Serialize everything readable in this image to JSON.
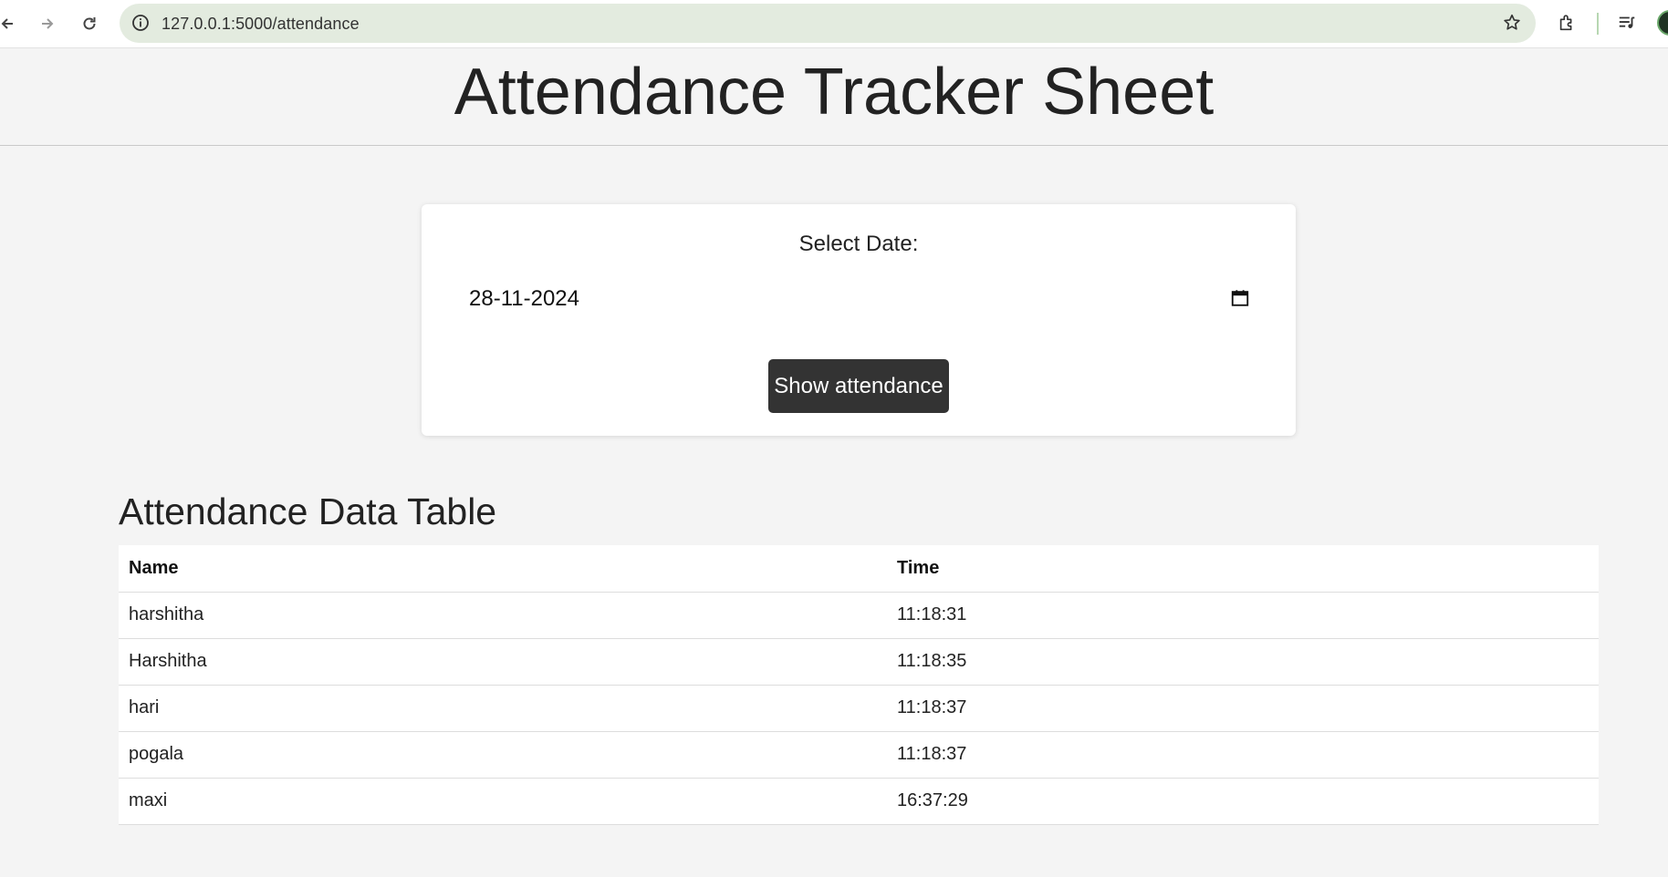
{
  "browser": {
    "url": "127.0.0.1:5000/attendance",
    "icons": [
      "back-arrow-icon",
      "forward-arrow-icon",
      "reload-icon",
      "site-info-icon",
      "bookmark-star-icon",
      "extensions-icon",
      "media-controls-icon",
      "profile-avatar"
    ]
  },
  "header": {
    "title": "Attendance Tracker Sheet"
  },
  "form": {
    "label": "Select Date:",
    "date_value": "28-11-2024",
    "button_label": "Show attendance"
  },
  "table": {
    "title": "Attendance Data Table",
    "columns": [
      "Name",
      "Time"
    ],
    "rows": [
      {
        "name": "harshitha",
        "time": "11:18:31"
      },
      {
        "name": "Harshitha",
        "time": "11:18:35"
      },
      {
        "name": "hari",
        "time": "11:18:37"
      },
      {
        "name": "pogala",
        "time": "11:18:37"
      },
      {
        "name": "maxi",
        "time": "16:37:29"
      }
    ]
  },
  "colors": {
    "button_bg": "#333333",
    "page_bg": "#f4f4f4",
    "omnibox_bg": "#e3ebdf"
  }
}
